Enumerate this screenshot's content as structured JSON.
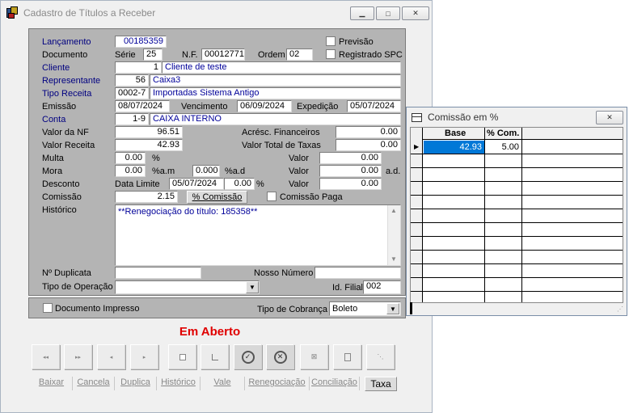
{
  "main": {
    "title": "Cadastro de Títulos a Receber",
    "labels": {
      "lancamento": "Lançamento",
      "documento": "Documento",
      "cliente": "Cliente",
      "representante": "Representante",
      "tipo_receita": "Tipo Receita",
      "emissao": "Emissão",
      "conta": "Conta",
      "valor_nf": "Valor da NF",
      "valor_receita": "Valor Receita",
      "multa": "Multa",
      "mora": "Mora",
      "desconto": "Desconto",
      "comissao": "Comissão",
      "historico": "Histórico",
      "serie": "Série",
      "nf": "N.F.",
      "ordem": "Ordem",
      "vencimento": "Vencimento",
      "expedicao": "Expedição",
      "acresc": "Acrésc. Financeiros",
      "valor_total_taxas": "Valor Total de Taxas",
      "valor": "Valor",
      "pct": "%",
      "pct_am": "%a.m",
      "pct_ad": "%a.d",
      "ad": "a.d.",
      "data_limite": "Data Limite",
      "n_duplicata": "Nº Duplicata",
      "nosso_numero": "Nosso Número",
      "tipo_operacao": "Tipo de Operação",
      "id_filial": "Id. Filial",
      "previsao": "Previsão",
      "registrado_spc": "Registrado SPC",
      "comissao_paga": "Comissão Paga",
      "documento_impresso": "Documento Impresso",
      "tipo_cobranca": "Tipo de Cobrança"
    },
    "values": {
      "lancamento": "00185359",
      "serie": "25",
      "nf": "00012771",
      "ordem": "02",
      "cliente_code": "1",
      "cliente_name": "Cliente de teste",
      "rep_code": "56",
      "rep_name": "Caixa3",
      "tipo_code": "0002-7",
      "tipo_name": "Importadas Sistema Antigo",
      "emissao": "08/07/2024",
      "vencimento": "06/09/2024",
      "expedicao": "05/07/2024",
      "conta_code": "1-9",
      "conta_name": "CAIXA INTERNO",
      "valor_nf": "96.51",
      "valor_receita": "42.93",
      "acresc": "0.00",
      "total_taxas": "0.00",
      "multa_pct": "0.00",
      "multa_valor": "0.00",
      "mora_am": "0.00",
      "mora_ad": "0.000",
      "mora_valor": "0.00",
      "data_limite": "05/07/2024",
      "desc_pct": "0.00",
      "desc_valor": "0.00",
      "comissao": "2.15",
      "historico": "**Renegociação do título: 185358**",
      "n_duplicata": "",
      "nosso_numero": "",
      "tipo_operacao": "",
      "id_filial": "002",
      "tipo_cobranca": "Boleto"
    },
    "comissao_button": "% Comissão",
    "status": "Em Aberto",
    "actions": [
      "Baixar",
      "Cancela",
      "Duplica",
      "Histórico",
      "Vale",
      "Renegociação",
      "Conciliação",
      "Taxa"
    ],
    "status_color": "#e00000"
  },
  "comissao_window": {
    "title": "Comissão em %",
    "columns": [
      "Base",
      "% Com."
    ],
    "rows": [
      {
        "base": "42.93",
        "pct": "5.00"
      }
    ],
    "selected_color": "#0078d7"
  }
}
